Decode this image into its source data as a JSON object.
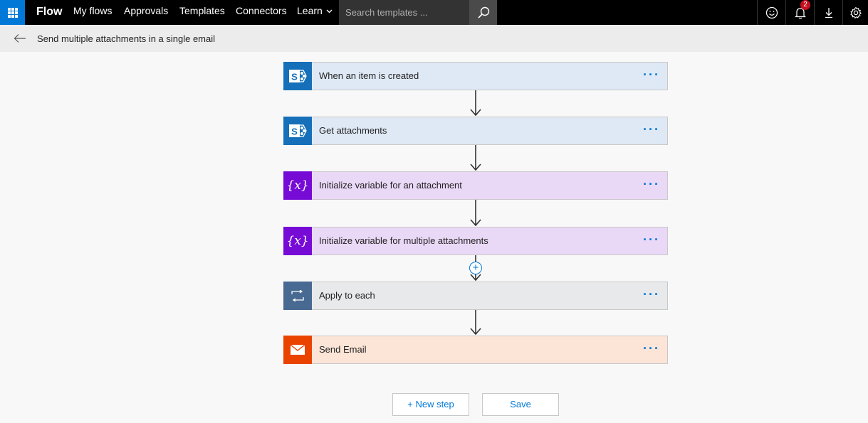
{
  "nav": {
    "brand": "Flow",
    "items": [
      "My flows",
      "Approvals",
      "Templates",
      "Connectors",
      "Learn"
    ],
    "search_placeholder": "Search templates ...",
    "notification_count": "2"
  },
  "subheader": {
    "title": "Send multiple attachments in a single email"
  },
  "steps": [
    {
      "label": "When an item is created",
      "more": "···",
      "icon": "sharepoint-icon"
    },
    {
      "label": "Get attachments",
      "more": "···",
      "icon": "sharepoint-icon"
    },
    {
      "label": "Initialize variable for an attachment",
      "more": "···",
      "icon": "variable-icon"
    },
    {
      "label": "Initialize variable for multiple attachments",
      "more": "···",
      "icon": "variable-icon"
    },
    {
      "label": "Apply to each",
      "more": "···",
      "icon": "loop-icon"
    },
    {
      "label": "Send Email",
      "more": "···",
      "icon": "mail-icon"
    }
  ],
  "insert_step": "+",
  "buttons": {
    "new_step": "+ New step",
    "save": "Save"
  },
  "colors": {
    "accent": "#0078d7",
    "sharepoint": "#1570b9",
    "variable": "#770bd6",
    "loop": "#486991",
    "mail": "#ea4300"
  }
}
